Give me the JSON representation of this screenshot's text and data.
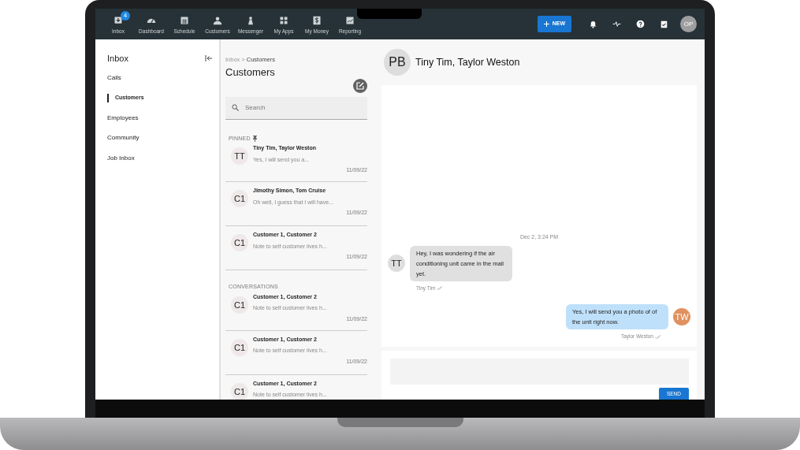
{
  "nav": {
    "items": [
      {
        "label": "Inbox",
        "badge": "4"
      },
      {
        "label": "Dashboard"
      },
      {
        "label": "Schedule"
      },
      {
        "label": "Customers"
      },
      {
        "label": "Messenger"
      },
      {
        "label": "My Apps"
      },
      {
        "label": "My Money"
      },
      {
        "label": "Reporting"
      }
    ],
    "new_button": "NEW",
    "user_initials": "OP"
  },
  "sidebar": {
    "title": "Inbox",
    "items": [
      {
        "label": "Calls",
        "selected": false
      },
      {
        "label": "Customers",
        "selected": true
      },
      {
        "label": "Employees",
        "selected": false
      },
      {
        "label": "Community",
        "selected": false
      },
      {
        "label": "Job Inbox",
        "selected": false
      }
    ]
  },
  "list": {
    "breadcrumb": [
      "Inbox",
      ">",
      "Customers"
    ],
    "title": "Customers",
    "search": {
      "placeholder": "Search"
    },
    "sections": [
      {
        "heading": "PINNED",
        "pinned": true,
        "conversations": [
          {
            "initials": "TT",
            "name": "Tiny Tim, Taylor Weston",
            "preview": "Yes, I will send you a...",
            "date": "11/09/22"
          },
          {
            "initials": "C1",
            "name": "Jimothy Simon, Tom Cruise",
            "preview": "Oh well, I guess that I will have...",
            "date": "11/09/22"
          },
          {
            "initials": "C1",
            "name": "Customer 1, Customer 2",
            "preview": "Note to self customer lives h...",
            "date": "11/09/22"
          }
        ]
      },
      {
        "heading": "CONVERSATIONS",
        "pinned": false,
        "conversations": [
          {
            "initials": "C1",
            "name": "Customer 1, Customer 2",
            "preview": "Note to self customer lives h...",
            "date": "11/09/22"
          },
          {
            "initials": "C1",
            "name": "Customer 1, Customer 2",
            "preview": "Note to self customer lives h...",
            "date": "11/09/22"
          },
          {
            "initials": "C1",
            "name": "Customer 1, Customer 2",
            "preview": "Note to self customer lives h..."
          }
        ]
      }
    ]
  },
  "chat": {
    "header": {
      "initials": "PB",
      "name": "Tiny Tim, Taylor Weston"
    },
    "timestamp": "Dec 2, 3:24 PM",
    "messages": [
      {
        "kind": "incoming",
        "initials": "TT",
        "text": "Hey, I was wondering if the air conditioning unit came in the mail yet.",
        "sender": "Tiny Tim",
        "color": "#dedede"
      },
      {
        "kind": "outgoing",
        "initials": "TW",
        "text": "Yes, I will send you a photo of of the unit right now.",
        "sender": "Taylor Weston",
        "color": "#e0915f"
      }
    ],
    "composer": {
      "send_label": "SEND"
    }
  }
}
